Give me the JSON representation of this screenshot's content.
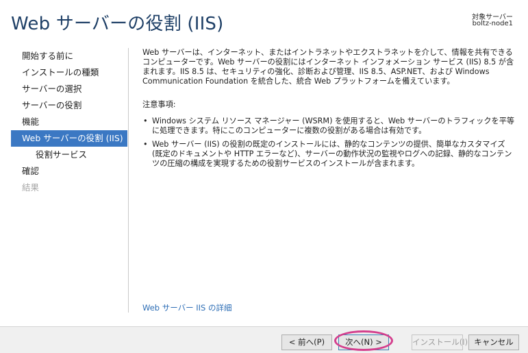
{
  "header": {
    "title": "Web サーバーの役割 (IIS)",
    "target_label": "対象サーバー",
    "target_name": "boltz-node1"
  },
  "nav": {
    "items": [
      {
        "label": "開始する前に",
        "state": "normal",
        "level": 0
      },
      {
        "label": "インストールの種類",
        "state": "normal",
        "level": 0
      },
      {
        "label": "サーバーの選択",
        "state": "normal",
        "level": 0
      },
      {
        "label": "サーバーの役割",
        "state": "normal",
        "level": 0
      },
      {
        "label": "機能",
        "state": "normal",
        "level": 0
      },
      {
        "label": "Web サーバーの役割 (IIS)",
        "state": "active",
        "level": 0
      },
      {
        "label": "役割サービス",
        "state": "normal",
        "level": 1
      },
      {
        "label": "確認",
        "state": "normal",
        "level": 0
      },
      {
        "label": "結果",
        "state": "disabled",
        "level": 0
      }
    ]
  },
  "content": {
    "intro": "Web サーバーは、インターネット、またはイントラネットやエクストラネットを介して、情報を共有できるコンピューターです。Web サーバーの役割にはインターネット インフォメーション サービス (IIS) 8.5 が含まれます。IIS 8.5 は、セキュリティの強化、診断および管理、IIS 8.5、ASP.NET、および Windows Communication Foundation を統合した、統合 Web プラットフォームを備えています。",
    "note_title": "注意事項:",
    "bullets": [
      "Windows システム リソース マネージャー (WSRM) を使用すると、Web サーバーのトラフィックを平等に処理できます。特にこのコンピューターに複数の役割がある場合は有効です。",
      "Web サーバー (IIS) の役割の既定のインストールには、静的なコンテンツの提供、簡単なカスタマイズ (既定のドキュメントや HTTP エラーなど)、サーバーの動作状況の監視やログへの記録、静的なコンテンツの圧縮の構成を実現するための役割サービスのインストールが含まれます。"
    ],
    "bullet_symbol": "•",
    "more_link": "Web サーバー IIS の詳細"
  },
  "footer": {
    "prev_label": "< 前へ(P)",
    "next_label": "次へ(N) >",
    "install_label": "インストール(I)",
    "cancel_label": "キャンセル"
  },
  "colors": {
    "title": "#1e3f66",
    "nav_active_bg": "#3b78c3",
    "link": "#2c6db5",
    "highlight_ring": "#d43f8d"
  }
}
